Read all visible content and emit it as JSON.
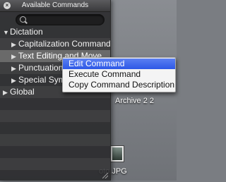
{
  "panel": {
    "title": "Available Commands",
    "close_glyph": "×",
    "search": {
      "placeholder": "",
      "value": ""
    },
    "rows": [
      {
        "label": "Dictation",
        "kind": "group",
        "expanded": true
      },
      {
        "label": "Capitalization Commands",
        "kind": "child"
      },
      {
        "label": "Text Editing and Move",
        "kind": "child",
        "selected": true
      },
      {
        "label": "Punctuation",
        "kind": "child"
      },
      {
        "label": "Special Symbols",
        "kind": "child"
      },
      {
        "label": "Global",
        "kind": "group",
        "expanded": false
      }
    ],
    "triangle_expanded": "▼",
    "triangle_collapsed": "▶"
  },
  "context_menu": {
    "items": [
      "Edit Command",
      "Execute Command",
      "Copy Command Description"
    ],
    "highlighted_index": 0
  },
  "desktop": {
    "archive_label": "Archive 2 2",
    "photo_label": "oto.JPG"
  },
  "colors": {
    "panel_bg": "#28282a",
    "menu_highlight": "#3a63ea"
  }
}
